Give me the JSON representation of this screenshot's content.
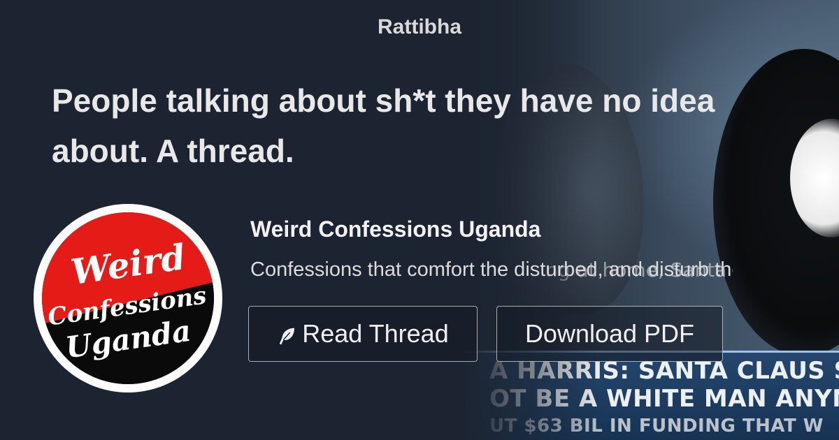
{
  "site": {
    "name": "Rattibha"
  },
  "thread": {
    "title": "People talking about sh*t they have no idea about. A thread."
  },
  "account": {
    "name": "Weird Confessions Uganda",
    "bio": "Confessions that comfort the disturbed, and disturb the comfortable.",
    "avatar_text": [
      "Weird",
      "Confessions",
      "Uganda"
    ]
  },
  "actions": {
    "read_label": "Read Thread",
    "download_label": "Download PDF"
  },
  "background": {
    "subtitle": "ng at home, Santa",
    "ticker_lines": [
      "A HARRIS: SANTA CLAUS SHO",
      "OT BE A WHITE MAN ANYMOR",
      "UT $63 BIL IN FUNDING THAT W"
    ]
  },
  "colors": {
    "background": "#1c2431",
    "avatar_red": "#e41b17",
    "avatar_black": "#0a0a0a",
    "ticker_blue": "#1f3f63"
  },
  "icons": {
    "read": "feather-icon"
  }
}
